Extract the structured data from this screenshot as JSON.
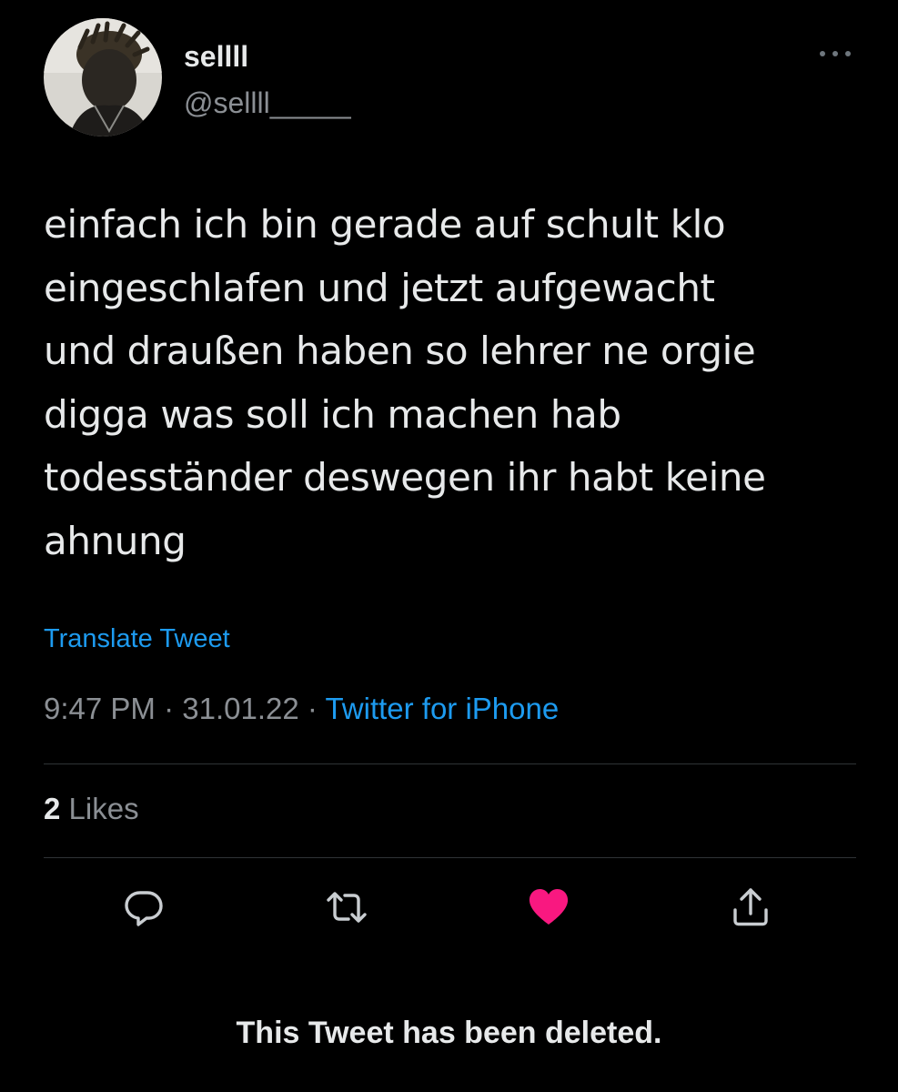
{
  "tweet": {
    "author": {
      "display_name": "sellll",
      "handle": "@sellll_____",
      "avatar_icon": "profile-photo"
    },
    "more_icon": "more-horizontal-icon",
    "text": "einfach ich bin gerade auf schult klo\neingeschlafen und jetzt aufgewacht\nund draußen haben so lehrer ne orgie\ndigga was soll ich machen hab\ntodesständer deswegen ihr habt keine\nahnung",
    "translate_label": "Translate Tweet",
    "time": "9:47 PM",
    "separator": " · ",
    "date": "31.01.22",
    "source": "Twitter for iPhone",
    "likes": {
      "count": "2",
      "label": "Likes"
    },
    "actions": [
      {
        "name": "reply",
        "icon": "reply-icon"
      },
      {
        "name": "retweet",
        "icon": "retweet-icon"
      },
      {
        "name": "like",
        "icon": "heart-icon",
        "state": "liked"
      },
      {
        "name": "share",
        "icon": "share-icon"
      }
    ]
  },
  "footer": {
    "deleted_notice": "This Tweet has been deleted."
  },
  "colors": {
    "background": "#000000",
    "text_primary": "#e7e9ea",
    "text_secondary": "#8b8f94",
    "link": "#1d9bf0",
    "like_active": "#f91880",
    "divider": "#2f3336"
  }
}
